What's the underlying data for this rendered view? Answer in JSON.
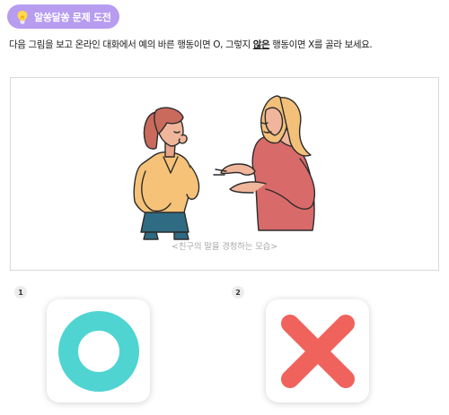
{
  "badge": {
    "label": "알쏭달쏭 문제 도전",
    "icon": "lightbulb-icon",
    "color": "#b79cf0"
  },
  "instruction": {
    "before": "다음 그림을 보고 온라인 대화에서 예의 바른 행동이면 O, 그렇지 ",
    "emphasis": "않은",
    "after": " 행동이면 X를 골라 보세요."
  },
  "illustration": {
    "caption": "<친구의 말을 경청하는 모습>"
  },
  "choices": [
    {
      "number": "1",
      "symbol": "O",
      "icon": "circle-o-icon",
      "color": "#4fd4d2"
    },
    {
      "number": "2",
      "symbol": "X",
      "icon": "cross-x-icon",
      "color": "#f0625c"
    }
  ]
}
